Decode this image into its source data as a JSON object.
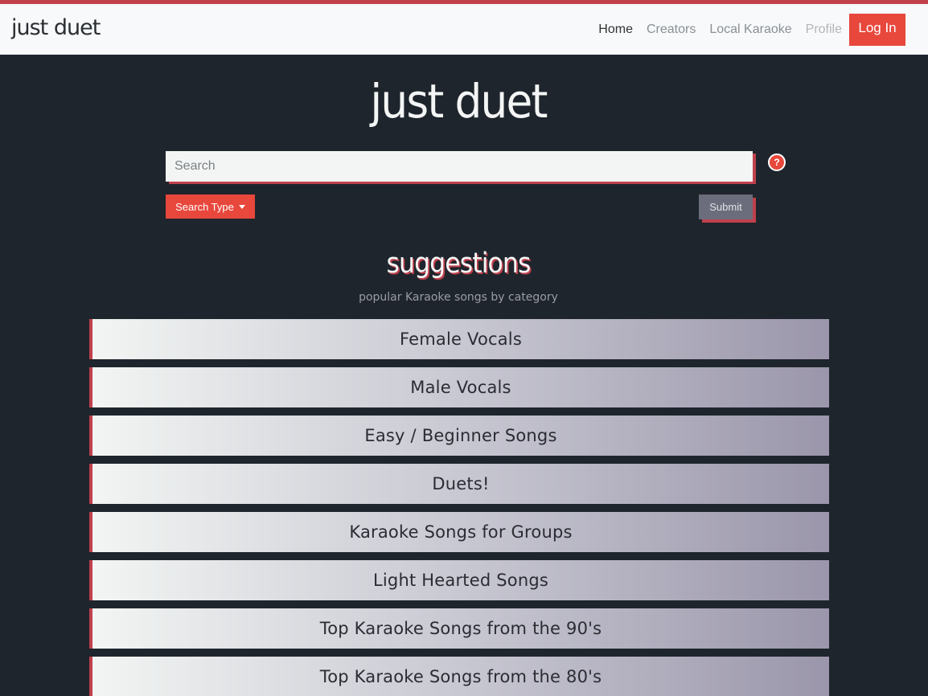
{
  "nav": {
    "brand": "just duet",
    "links": [
      "Home",
      "Creators",
      "Local Karaoke",
      "Profile"
    ],
    "login": "Log In"
  },
  "hero": {
    "title": "just duet"
  },
  "search": {
    "placeholder": "Search",
    "help": "?",
    "type_label": "Search Type",
    "submit_label": "Submit"
  },
  "suggestions": {
    "title": "suggestions",
    "subtitle": "popular Karaoke songs by category",
    "categories": [
      "Female Vocals",
      "Male Vocals",
      "Easy / Beginner Songs",
      "Duets!",
      "Karaoke Songs for Groups",
      "Light Hearted Songs",
      "Top Karaoke Songs from the 90's",
      "Top Karaoke Songs from the 80's"
    ]
  },
  "colors": {
    "accent": "#e8473c",
    "shadow": "#c0404c",
    "background": "#1f252c"
  }
}
